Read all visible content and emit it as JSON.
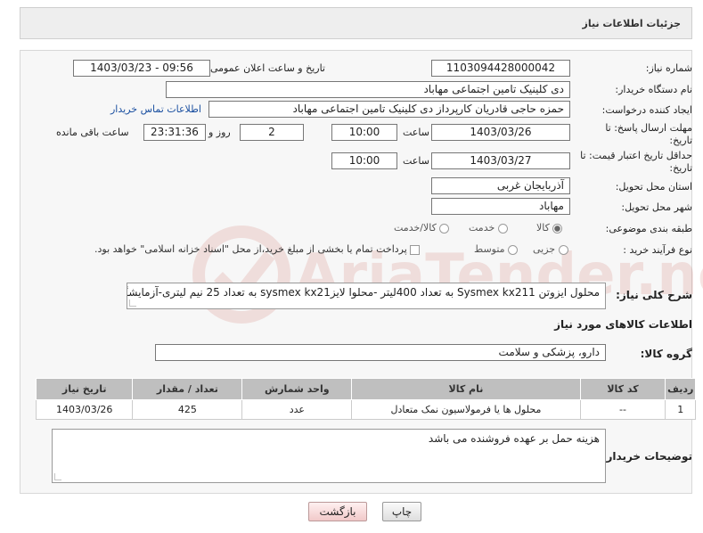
{
  "header": {
    "title": "جزئیات اطلاعات نیاز"
  },
  "form": {
    "need_number_label": "شماره نیاز:",
    "need_number": "1103094428000042",
    "announce_label": "تاریخ و ساعت اعلان عمومی:",
    "announce_value": "1403/03/23 - 09:56",
    "buyer_org_label": "نام دستگاه خریدار:",
    "buyer_org": "دی کلینیک تامین اجتماعی مهاباد",
    "requester_label": "ایجاد کننده درخواست:",
    "requester": "حمزه حاجی قادریان کارپرداز دی کلینیک تامین اجتماعی مهاباد",
    "contact_link": "اطلاعات تماس خریدار",
    "reply_deadline_label": "مهلت ارسال پاسخ: تا",
    "reply_deadline_label2": "تاریخ:",
    "reply_date": "1403/03/26",
    "time_label": "ساعت",
    "reply_time": "10:00",
    "days_value": "2",
    "days_label": "روز و",
    "remaining_time": "23:31:36",
    "remaining_label": "ساعت باقی مانده",
    "validity_label": "حداقل تاریخ اعتبار قیمت: تا",
    "validity_label2": "تاریخ:",
    "validity_date": "1403/03/27",
    "validity_time": "10:00",
    "province_label": "استان محل تحویل:",
    "province": "آذربایجان غربی",
    "city_label": "شهر محل تحویل:",
    "city": "مهاباد",
    "category_label": "طبقه بندی موضوعی:",
    "category_options": [
      "کالا",
      "خدمت",
      "کالا/خدمت"
    ],
    "process_label": "نوع فرآیند خرید :",
    "process_options": [
      "جزیی",
      "متوسط"
    ],
    "payment_note": "پرداخت تمام یا بخشی از مبلغ خرید،از محل \"اسناد خزانه اسلامی\" خواهد بود."
  },
  "description": {
    "label": "شرح کلی نیاز:",
    "text": "محلول ایزوتن Sysmex kx211  به تعداد 400لیتر -محلوا لایزsysmex kx21  به تعداد 25 نیم لیتری-آزمایشگاهی"
  },
  "goods": {
    "section_title": "اطلاعات کالاهای مورد نیاز",
    "group_label": "گروه کالا:",
    "group_value": "دارو، پزشکی و سلامت",
    "columns": [
      "ردیف",
      "کد کالا",
      "نام کالا",
      "واحد شمارش",
      "تعداد / مقدار",
      "تاریخ نیاز"
    ],
    "rows": [
      {
        "index": "1",
        "code": "--",
        "name": "محلول ها یا فرمولاسیون نمک متعادل",
        "unit": "عدد",
        "qty": "425",
        "date": "1403/03/26"
      }
    ]
  },
  "buyer_notes": {
    "label": "توضیحات خریدار:",
    "text": "هزینه حمل بر عهده فروشنده می باشد"
  },
  "buttons": {
    "print": "چاپ",
    "back": "بازگشت"
  },
  "watermark": {
    "text": "AriaTender.neT"
  },
  "colors": {
    "link": "#1a4fa0",
    "table_header": "#bfbfbf",
    "watermark": "#c0392b"
  }
}
